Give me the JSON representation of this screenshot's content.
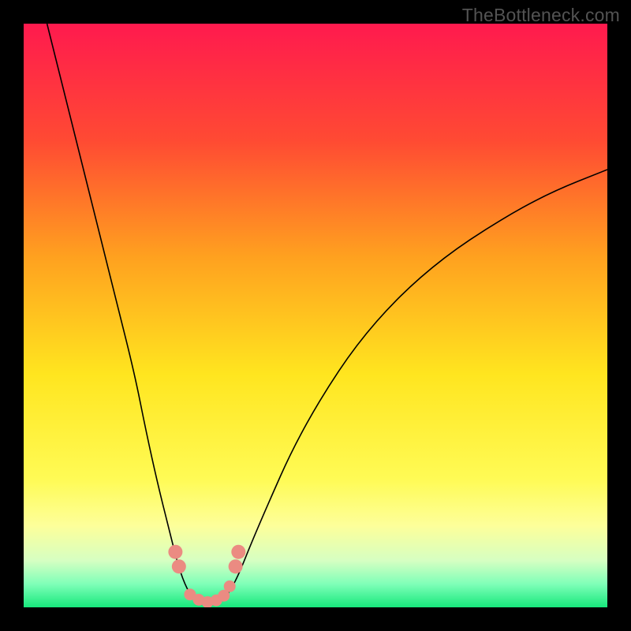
{
  "watermark": "TheBottleneck.com",
  "chart_data": {
    "type": "line",
    "title": "",
    "xlabel": "",
    "ylabel": "",
    "xlim": [
      0,
      100
    ],
    "ylim": [
      0,
      100
    ],
    "grid": false,
    "gradient_stops": [
      {
        "offset": 0.0,
        "color": "#ff1a4e"
      },
      {
        "offset": 0.2,
        "color": "#ff4a33"
      },
      {
        "offset": 0.4,
        "color": "#ffa11f"
      },
      {
        "offset": 0.6,
        "color": "#ffe51f"
      },
      {
        "offset": 0.78,
        "color": "#fffb55"
      },
      {
        "offset": 0.86,
        "color": "#fdff9a"
      },
      {
        "offset": 0.92,
        "color": "#d6ffc2"
      },
      {
        "offset": 0.96,
        "color": "#7fffb8"
      },
      {
        "offset": 1.0,
        "color": "#17e87c"
      }
    ],
    "series": [
      {
        "name": "bottleneck-curve",
        "stroke": "#000000",
        "points": [
          {
            "x": 4.0,
            "y": 100.0
          },
          {
            "x": 7.0,
            "y": 88.0
          },
          {
            "x": 10.0,
            "y": 76.0
          },
          {
            "x": 13.0,
            "y": 64.0
          },
          {
            "x": 16.0,
            "y": 52.0
          },
          {
            "x": 19.0,
            "y": 40.0
          },
          {
            "x": 21.0,
            "y": 30.0
          },
          {
            "x": 23.0,
            "y": 21.0
          },
          {
            "x": 25.0,
            "y": 13.0
          },
          {
            "x": 26.5,
            "y": 7.0
          },
          {
            "x": 28.0,
            "y": 3.0
          },
          {
            "x": 29.5,
            "y": 1.0
          },
          {
            "x": 31.0,
            "y": 0.5
          },
          {
            "x": 32.5,
            "y": 0.5
          },
          {
            "x": 34.0,
            "y": 1.0
          },
          {
            "x": 35.5,
            "y": 3.0
          },
          {
            "x": 37.0,
            "y": 6.0
          },
          {
            "x": 39.0,
            "y": 11.0
          },
          {
            "x": 42.0,
            "y": 18.0
          },
          {
            "x": 46.0,
            "y": 27.0
          },
          {
            "x": 51.0,
            "y": 36.0
          },
          {
            "x": 57.0,
            "y": 45.0
          },
          {
            "x": 64.0,
            "y": 53.0
          },
          {
            "x": 72.0,
            "y": 60.0
          },
          {
            "x": 81.0,
            "y": 66.0
          },
          {
            "x": 90.0,
            "y": 71.0
          },
          {
            "x": 100.0,
            "y": 75.0
          }
        ]
      },
      {
        "name": "highlight-dots",
        "stroke": "#eb8b82",
        "points_r_large": [
          {
            "x": 26.0,
            "y": 9.5
          },
          {
            "x": 26.6,
            "y": 7.0
          },
          {
            "x": 36.3,
            "y": 7.0
          },
          {
            "x": 36.8,
            "y": 9.5
          }
        ],
        "points_r_small": [
          {
            "x": 28.5,
            "y": 2.2
          },
          {
            "x": 30.0,
            "y": 1.3
          },
          {
            "x": 31.5,
            "y": 0.9
          },
          {
            "x": 33.0,
            "y": 1.2
          },
          {
            "x": 34.3,
            "y": 2.0
          },
          {
            "x": 35.3,
            "y": 3.6
          }
        ]
      }
    ]
  }
}
